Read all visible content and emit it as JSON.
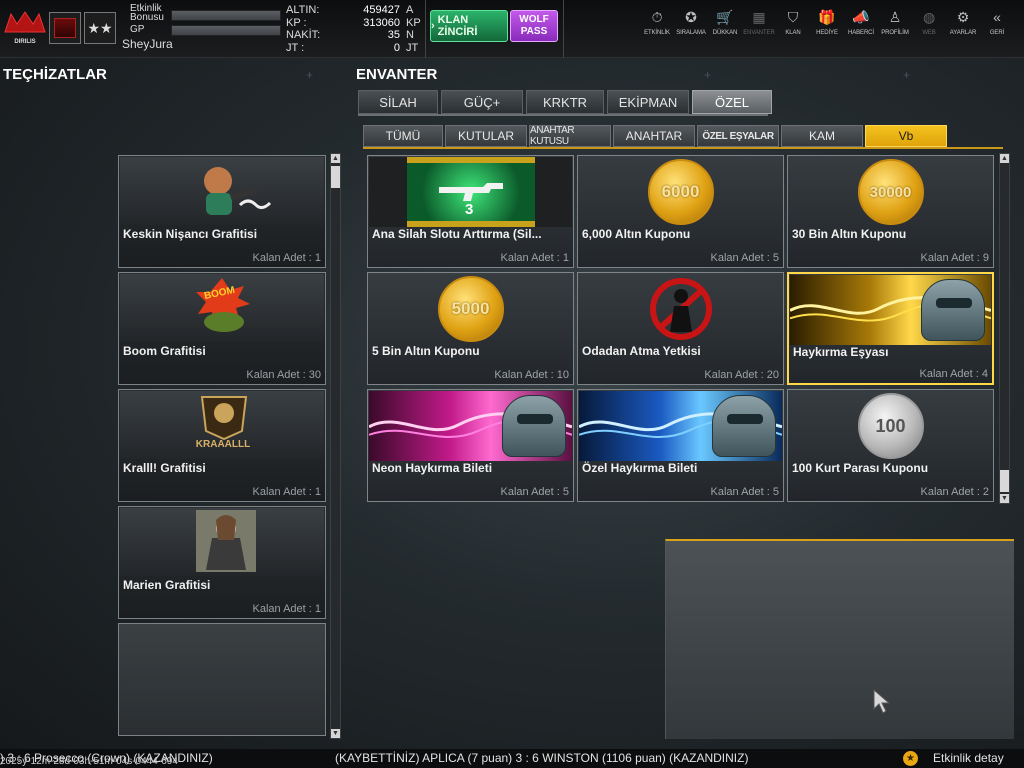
{
  "topbar": {
    "logo_text": "DIRILIS",
    "rank_stars": "★★",
    "bonus_label_1": "Etkinlik",
    "bonus_label_2": "Bonusu",
    "gp_label": "GP",
    "username": "SheyJura",
    "currency": [
      {
        "key": "ALTIN:",
        "value": "459427",
        "unit": "A"
      },
      {
        "key": "KP :",
        "value": "313060",
        "unit": "KP"
      },
      {
        "key": "NAKİT:",
        "value": "35",
        "unit": "N"
      },
      {
        "key": "JT :",
        "value": "0",
        "unit": "JT"
      }
    ],
    "klan_button": "KLAN ZİNCİRİ",
    "wolf_button_1": "WOLF",
    "wolf_button_2": "PASS",
    "nav": [
      {
        "label": "ETKİNLİK",
        "icon": "stopwatch-icon",
        "glyph": "⏱"
      },
      {
        "label": "SIRALAMA",
        "icon": "medal-icon",
        "glyph": "✪"
      },
      {
        "label": "DÜKKAN",
        "icon": "cart-icon",
        "glyph": "🛒"
      },
      {
        "label": "ENVANTER",
        "icon": "inventory-icon",
        "glyph": "▦"
      },
      {
        "label": "KLAN",
        "icon": "shield-icon",
        "glyph": "⛉"
      },
      {
        "label": "HEDİYE",
        "icon": "gift-icon",
        "glyph": "🎁"
      },
      {
        "label": "HABERCİ",
        "icon": "megaphone-icon",
        "glyph": "📣"
      },
      {
        "label": "PROFİLİM",
        "icon": "profile-icon",
        "glyph": "♙"
      },
      {
        "label": "WEB",
        "icon": "globe-icon",
        "glyph": "◍"
      },
      {
        "label": "AYARLAR",
        "icon": "gear-icon",
        "glyph": "⚙"
      },
      {
        "label": "GERİ",
        "icon": "back-icon",
        "glyph": "«"
      }
    ]
  },
  "equipment": {
    "title": "TEÇHİZATLAR",
    "items": [
      {
        "name": "Keskin Nişancı Grafitisi",
        "count": "Kalan Adet : 1"
      },
      {
        "name": "Boom Grafitisi",
        "count": "Kalan Adet : 30"
      },
      {
        "name": "Kralll! Grafitisi",
        "count": "Kalan Adet : 1"
      },
      {
        "name": "Marien Grafitisi",
        "count": "Kalan Adet : 1"
      }
    ],
    "kraal_text": "KRAAALLL",
    "boom_text": "BOOM"
  },
  "inventory": {
    "title": "ENVANTER",
    "tabs": [
      "SİLAH",
      "GÜÇ+",
      "KRKTR",
      "EKİPMAN",
      "ÖZEL"
    ],
    "active_tab": 4,
    "subtabs": [
      "TÜMÜ",
      "KUTULAR",
      "ANAHTAR KUTUSU",
      "ANAHTAR",
      "ÖZEL EŞYALAR",
      "KAM",
      "Vb"
    ],
    "active_subtab": 6,
    "items": [
      {
        "name": "Ana Silah Slotu Arttırma (Sil...",
        "count": "Kalan Adet : 1",
        "badge": "3"
      },
      {
        "name": "6,000 Altın Kuponu",
        "count": "Kalan Adet : 5",
        "coin": "6000"
      },
      {
        "name": "30 Bin Altın Kuponu",
        "count": "Kalan Adet : 9",
        "coin": "30000"
      },
      {
        "name": "5 Bin Altın Kuponu",
        "count": "Kalan Adet : 10",
        "coin": "5000"
      },
      {
        "name": "Odadan Atma Yetkisi",
        "count": "Kalan Adet : 20"
      },
      {
        "name": "Haykırma Eşyası",
        "count": "Kalan Adet : 4"
      },
      {
        "name": "Neon Haykırma Bileti",
        "count": "Kalan Adet : 5"
      },
      {
        "name": "Özel Haykırma Bileti",
        "count": "Kalan Adet : 5"
      },
      {
        "name": "100 Kurt Parası Kuponu",
        "count": "Kalan Adet : 2",
        "coin": "100"
      }
    ]
  },
  "ticker": {
    "text1": ") 3 : 6 Prosecco (Crown) (KAZANDINIZ)",
    "text2": "(KAYBETTİNİZ) APLICA (7 puan) 3 : 6 WINSTON (1106 puan) (KAZANDINIZ)",
    "text3": "Etkinlik detay",
    "timestamp": "2025y-12m-28d-03h-51m-04s-0444-694"
  },
  "colors": {
    "accent": "#e0a40a",
    "klan_green": "#13683a",
    "wolf_purple": "#8a2bbc"
  }
}
